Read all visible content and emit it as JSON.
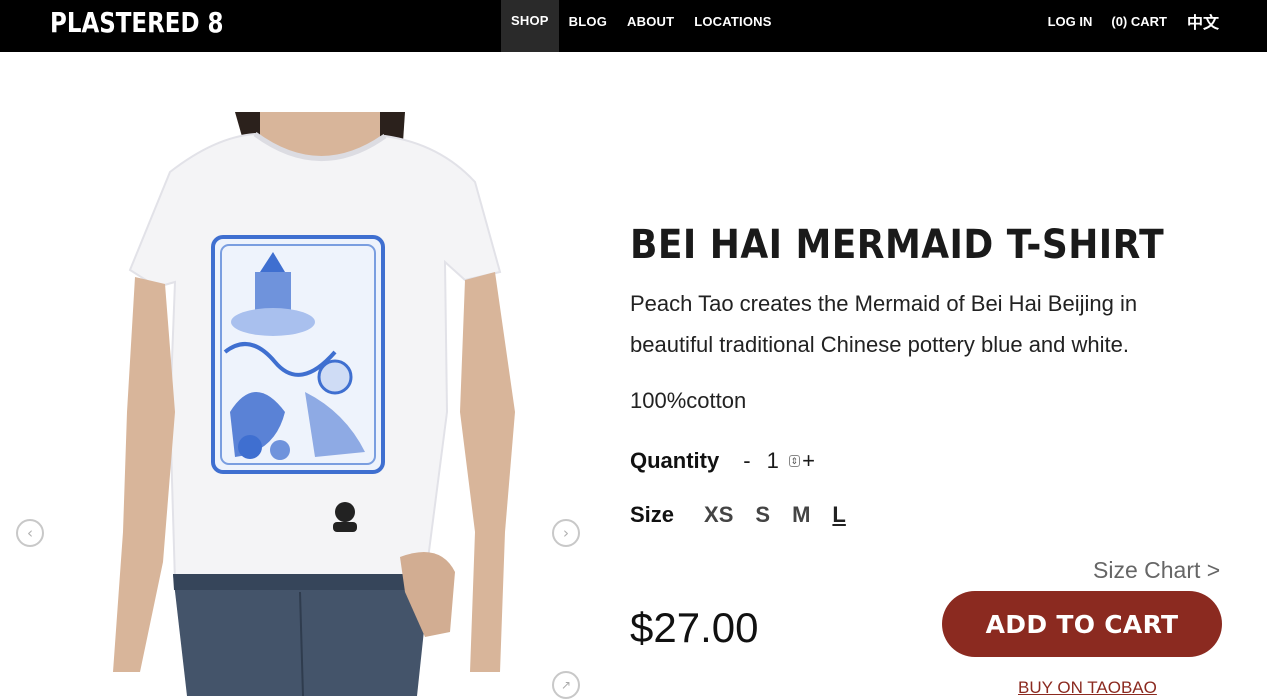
{
  "header": {
    "logo": "PLASTERED 8",
    "nav": [
      "SHOP",
      "BLOG",
      "ABOUT",
      "LOCATIONS"
    ],
    "active_nav": "SHOP",
    "login": "LOG IN",
    "cart": "(0) CART",
    "language": "中文"
  },
  "product": {
    "title": "BEI HAI MERMAID T-SHIRT",
    "description": "Peach Tao creates the Mermaid of Bei Hai Beijing in beautiful traditional Chinese pottery blue and white.",
    "material": "100%cotton",
    "quantity_label": "Quantity",
    "quantity_minus": "-",
    "quantity_value": "1",
    "quantity_plus": "+",
    "size_label": "Size",
    "sizes": [
      "XS",
      "S",
      "M",
      "L"
    ],
    "selected_size": "L",
    "size_chart": "Size Chart >",
    "price": "$27.00",
    "add_to_cart": "ADD TO CART",
    "buy_taobao": "BUY ON TAOBAO"
  },
  "gallery": {
    "prev_icon": "chevron-left-icon",
    "next_icon": "chevron-right-icon",
    "zoom_icon": "expand-icon"
  },
  "colors": {
    "topbar": "#000000",
    "accent": "#8b2a20",
    "print_blue": "#3f6fd0"
  }
}
